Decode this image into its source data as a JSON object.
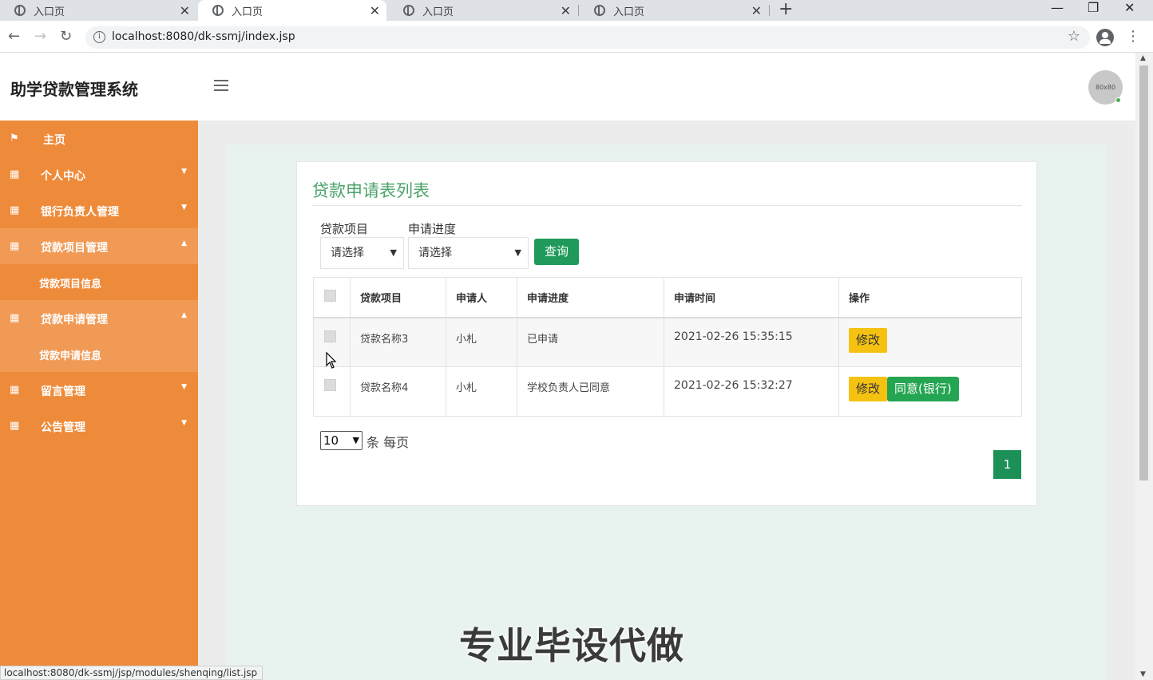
{
  "browser": {
    "tabs": [
      {
        "title": "入口页",
        "active": false
      },
      {
        "title": "入口页",
        "active": true
      },
      {
        "title": "入口页",
        "active": false
      },
      {
        "title": "入口页",
        "active": false
      }
    ],
    "url": "localhost:8080/dk-ssmj/index.jsp",
    "status_url": "localhost:8080/dk-ssmj/jsp/modules/shenqing/list.jsp"
  },
  "header": {
    "brand": "助学贷款管理系统",
    "avatar_text": "80x80"
  },
  "sidebar": {
    "items": [
      {
        "label": "主页",
        "icon": "flag-icon"
      },
      {
        "label": "个人中心",
        "icon": "grid-icon"
      },
      {
        "label": "银行负责人管理",
        "icon": "grid-icon"
      },
      {
        "label": "贷款项目管理",
        "icon": "grid-icon",
        "expanded": true
      },
      {
        "label": "贷款项目信息",
        "sub": true
      },
      {
        "label": "贷款申请管理",
        "icon": "grid-icon",
        "expanded": true
      },
      {
        "label": "贷款申请信息",
        "sub": true
      },
      {
        "label": "留言管理",
        "icon": "grid-icon"
      },
      {
        "label": "公告管理",
        "icon": "grid-icon"
      }
    ]
  },
  "main": {
    "title": "贷款申请表列表",
    "filters": {
      "project_label": "贷款项目",
      "project_value": "请选择",
      "progress_label": "申请进度",
      "progress_value": "请选择",
      "query_button": "查询"
    },
    "table": {
      "headers": [
        "贷款项目",
        "申请人",
        "申请进度",
        "申请时间",
        "操作"
      ],
      "rows": [
        {
          "project": "贷款名称3",
          "applicant": "小札",
          "progress": "已申请",
          "time": "2021-02-26 15:35:15",
          "actions": [
            "修改"
          ]
        },
        {
          "project": "贷款名称4",
          "applicant": "小札",
          "progress": "学校负责人已同意",
          "time": "2021-02-26 15:32:27",
          "actions": [
            "修改",
            "同意(银行)"
          ]
        }
      ]
    },
    "pagination": {
      "page_size": "10",
      "per_page_label": "条 每页",
      "current_page": "1"
    }
  },
  "watermark": "专业毕设代做",
  "colors": {
    "sidebar": "#ee8b3a",
    "accent_green": "#1f9a5a",
    "title_green": "#4aa26a",
    "edit_yellow": "#f5c211"
  }
}
